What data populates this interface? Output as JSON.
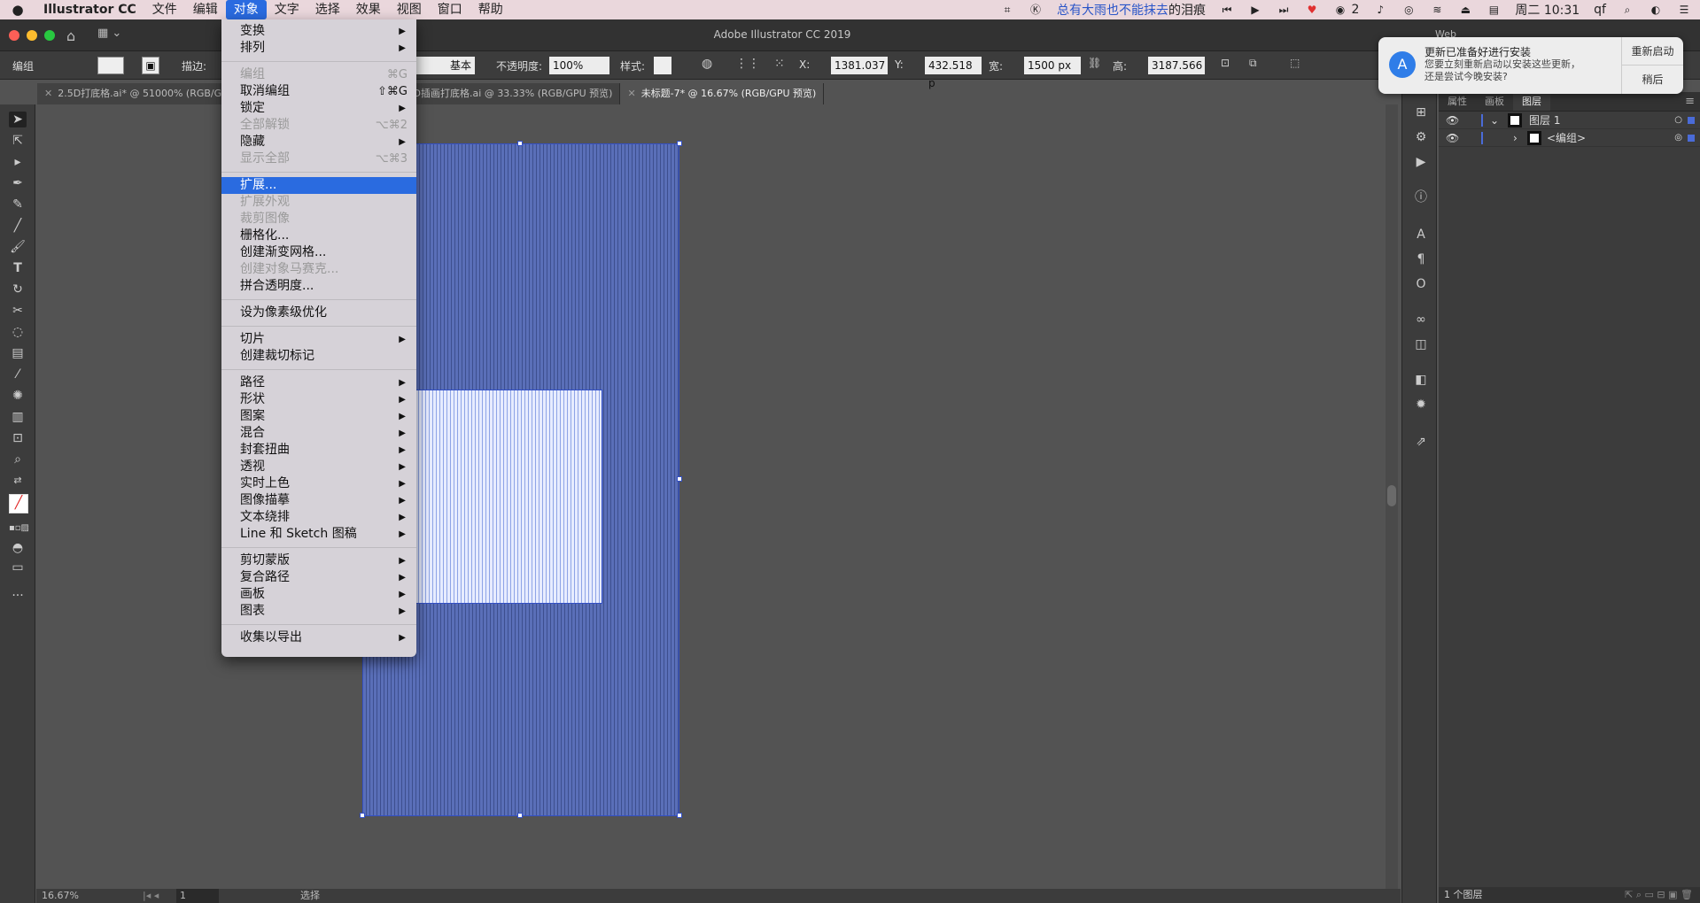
{
  "menubar": {
    "app": "Illustrator CC",
    "items": [
      "文件",
      "编辑",
      "对象",
      "文字",
      "选择",
      "效果",
      "视图",
      "窗口",
      "帮助"
    ],
    "active_index": 2,
    "right": {
      "song": "总有大雨也不能抹去",
      "song_tail": "的泪痕",
      "wechat_count": "2",
      "time": "周二 10:31",
      "user": "qf"
    }
  },
  "titlebar": {
    "title": "Adobe Illustrator CC 2019",
    "workspace": "Web"
  },
  "controlbar": {
    "selection_label": "编组",
    "stroke_label": "描边:",
    "stroke_style": "基本",
    "opacity_label": "不透明度:",
    "opacity_value": "100%",
    "style_label": "样式:",
    "x_label": "X:",
    "x_value": "1381.037",
    "y_label": "Y:",
    "y_value": "432.518 p",
    "w_label": "宽:",
    "w_value": "1500 px",
    "h_label": "高:",
    "h_value": "3187.566"
  },
  "tabs": [
    {
      "label": "2.5D打底格.ai* @ 51000% (RGB/GPU",
      "active": false
    },
    {
      "label": "2.5D插画打底格.ai @ 33.33% (RGB/GPU 预览)",
      "active": false
    },
    {
      "label": "未标题-7* @ 16.67% (RGB/GPU 预览)",
      "active": true
    }
  ],
  "menu": {
    "items": [
      {
        "label": "变换",
        "sub": true
      },
      {
        "label": "排列",
        "sub": true
      },
      {
        "sep": true
      },
      {
        "label": "编组",
        "shortcut": "⌘G",
        "disabled": true
      },
      {
        "label": "取消编组",
        "shortcut": "⇧⌘G"
      },
      {
        "label": "锁定",
        "sub": true
      },
      {
        "label": "全部解锁",
        "shortcut": "⌥⌘2",
        "disabled": true
      },
      {
        "label": "隐藏",
        "sub": true
      },
      {
        "label": "显示全部",
        "shortcut": "⌥⌘3",
        "disabled": true
      },
      {
        "sep": true
      },
      {
        "label": "扩展...",
        "highlight": true
      },
      {
        "label": "扩展外观",
        "disabled": true
      },
      {
        "label": "裁剪图像",
        "disabled": true
      },
      {
        "label": "栅格化..."
      },
      {
        "label": "创建渐变网格..."
      },
      {
        "label": "创建对象马赛克...",
        "disabled": true
      },
      {
        "label": "拼合透明度..."
      },
      {
        "sep": true
      },
      {
        "label": "设为像素级优化"
      },
      {
        "sep": true
      },
      {
        "label": "切片",
        "sub": true
      },
      {
        "label": "创建裁切标记"
      },
      {
        "sep": true
      },
      {
        "label": "路径",
        "sub": true
      },
      {
        "label": "形状",
        "sub": true
      },
      {
        "label": "图案",
        "sub": true
      },
      {
        "label": "混合",
        "sub": true
      },
      {
        "label": "封套扭曲",
        "sub": true
      },
      {
        "label": "透视",
        "sub": true
      },
      {
        "label": "实时上色",
        "sub": true
      },
      {
        "label": "图像描摹",
        "sub": true
      },
      {
        "label": "文本绕排",
        "sub": true
      },
      {
        "label": "Line 和 Sketch 图稿",
        "sub": true
      },
      {
        "sep": true
      },
      {
        "label": "剪切蒙版",
        "sub": true
      },
      {
        "label": "复合路径",
        "sub": true
      },
      {
        "label": "画板",
        "sub": true
      },
      {
        "label": "图表",
        "sub": true
      },
      {
        "sep": true
      },
      {
        "label": "收集以导出",
        "sub": true
      }
    ]
  },
  "notification": {
    "title": "更新已准备好进行安装",
    "body": "您要立刻重新启动以安装这些更新，还是尝试今晚安装?",
    "restart": "重新启动",
    "later": "稍后"
  },
  "panel": {
    "tabs": [
      "属性",
      "画板",
      "图层"
    ],
    "active_tab": 2,
    "layers": [
      {
        "name": "图层 1",
        "expanded": true
      },
      {
        "name": "<编组>",
        "expanded": false
      }
    ],
    "footer": "1 个图层"
  },
  "status": {
    "zoom": "16.67%",
    "page": "1",
    "tool": "选择"
  }
}
